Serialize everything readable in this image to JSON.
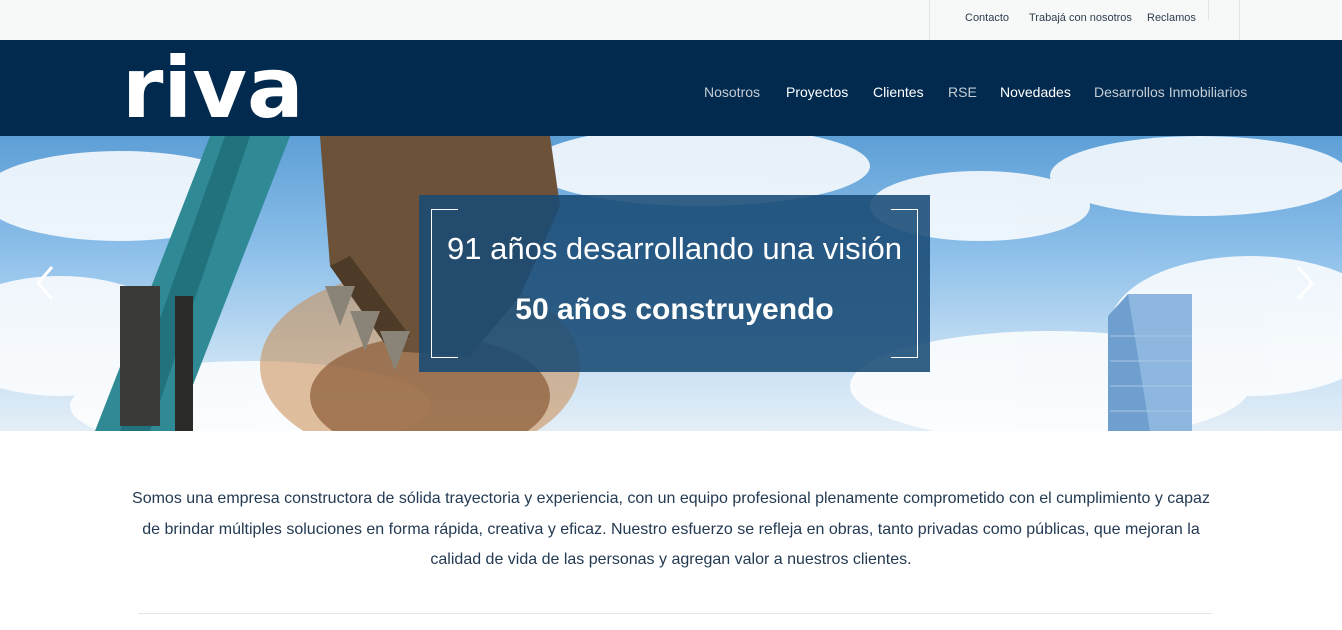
{
  "topbar": {
    "links": [
      {
        "label": "Contacto"
      },
      {
        "label": "Trabajá con nosotros"
      },
      {
        "label": "Reclamos"
      }
    ]
  },
  "header": {
    "logo_text": "riva",
    "nav": [
      {
        "label": "Nosotros",
        "active": false
      },
      {
        "label": "Proyectos",
        "active": true
      },
      {
        "label": "Clientes",
        "active": true
      },
      {
        "label": "RSE",
        "active": false
      },
      {
        "label": "Novedades",
        "active": true
      },
      {
        "label": "Desarrollos Inmobiliarios",
        "active": false
      }
    ]
  },
  "hero": {
    "line1": "91 años desarrollando una visión",
    "line2": "50 años construyendo",
    "prev_icon": "chevron-left-icon",
    "next_icon": "chevron-right-icon"
  },
  "intro": {
    "text": "Somos una empresa constructora de sólida trayectoria y experiencia, con un equipo profesional plenamente comprometido con el cumplimiento y capaz de brindar múltiples soluciones en forma rápida, creativa y eficaz. Nuestro esfuerzo se refleja en obras, tanto privadas como públicas, que mejoran la calidad de vida de las personas y agregan valor a nuestros clientes."
  },
  "colors": {
    "nav_background": "#022a4e",
    "topbar_background": "#f7f8f8",
    "hero_box": "#184a74",
    "body_text": "#233a52"
  }
}
